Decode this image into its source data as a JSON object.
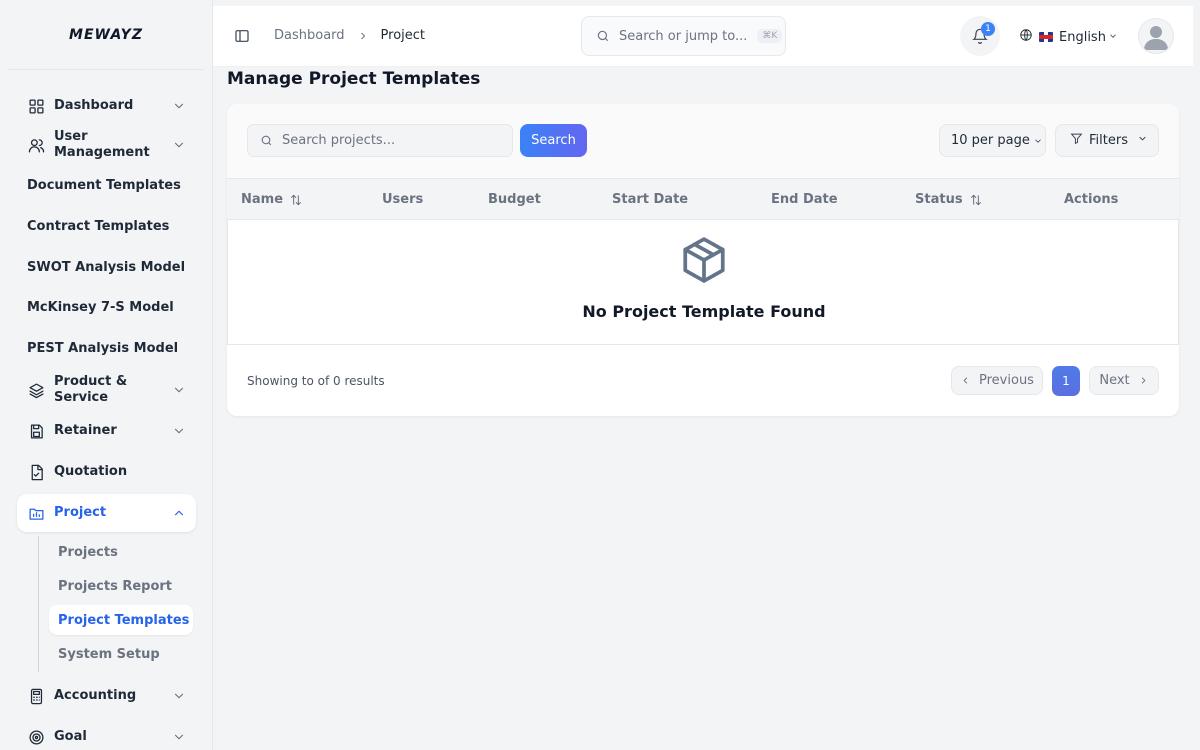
{
  "brand": {
    "logo_text": "MEWAYZ"
  },
  "sidebar": {
    "items": [
      {
        "label": "Dashboard",
        "icon": "grid-icon"
      },
      {
        "label": "User Management",
        "icon": "users-icon"
      },
      {
        "label": "Document Templates"
      },
      {
        "label": "Contract Templates"
      },
      {
        "label": "SWOT Analysis Model"
      },
      {
        "label": "McKinsey 7-S Model"
      },
      {
        "label": "PEST Analysis Model"
      },
      {
        "label": "Product & Service",
        "icon": "layers-icon"
      },
      {
        "label": "Retainer",
        "icon": "save-icon"
      },
      {
        "label": "Quotation",
        "icon": "file-icon"
      },
      {
        "label": "Project",
        "icon": "folder-chart-icon"
      },
      {
        "label": "Accounting",
        "icon": "calculator-icon"
      },
      {
        "label": "Goal",
        "icon": "target-icon"
      }
    ],
    "project_sub": [
      {
        "label": "Projects"
      },
      {
        "label": "Projects Report"
      },
      {
        "label": "Project Templates"
      },
      {
        "label": "System Setup"
      }
    ],
    "active_color": "#2563eb"
  },
  "header": {
    "breadcrumb": [
      "Dashboard",
      "Project"
    ],
    "search_placeholder": "Search or jump to...",
    "search_shortcut": "⌘K",
    "notification_count": "1",
    "language": "English"
  },
  "main": {
    "title": "Manage Project Templates",
    "search_placeholder": "Search projects...",
    "search_button": "Search",
    "per_page": "10 per page",
    "filters_label": "Filters",
    "columns": [
      "Name",
      "Users",
      "Budget",
      "Start Date",
      "End Date",
      "Status",
      "Actions"
    ],
    "empty_message": "No Project Template Found",
    "showing_text": "Showing to of 0 results",
    "pagination": {
      "previous": "Previous",
      "current": "1",
      "next": "Next"
    }
  }
}
